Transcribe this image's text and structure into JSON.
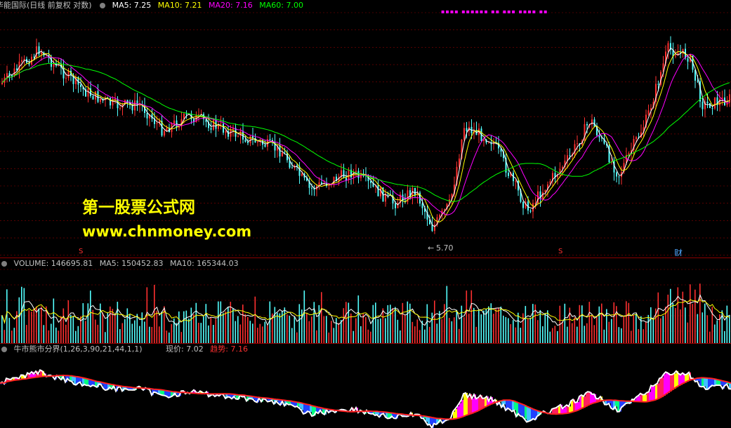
{
  "main_header": {
    "title": "华能国际(日线 前复权 对数)",
    "ma5": "MA5: 7.25",
    "ma10": "MA10: 7.21",
    "ma20": "MA20: 7.16",
    "ma60": "MA60: 7.00"
  },
  "colors": {
    "up": "#ff3030",
    "down": "#54ffff",
    "ma5": "#ffffff",
    "ma10": "#ffff00",
    "ma20": "#ff00ff",
    "ma60": "#00ff00",
    "grid": "#8b0000"
  },
  "watermark": {
    "line1": "第一股票公式网",
    "line2": "www.chnmoney.com"
  },
  "annotations": {
    "low_arrow": "←",
    "low_value": "5.70",
    "cai": "财",
    "s_mark": "S"
  },
  "top_dots": "▪▪▪▪ ▪▪▪▪▪▪ ▪▪ ▪▪▪ ▪▪▪▪ ▪▪",
  "volume_header": {
    "volume": "VOLUME: 146695.81",
    "ma5": "MA5: 150452.83",
    "ma10": "MA10: 165344.03"
  },
  "indicator_header": {
    "name": "牛市熊市分界(1,26,3,90,21,44,1,1)",
    "price": "现价: 7.02",
    "trend_label": "趋势: 7.16"
  },
  "icons": [
    "settings-dot-icon"
  ],
  "chart_data": [
    {
      "type": "candlestick",
      "title": "华能国际(日线 前复权 对数)",
      "series": [
        {
          "name": "MA5",
          "value": 7.25
        },
        {
          "name": "MA10",
          "value": 7.21
        },
        {
          "name": "MA20",
          "value": 7.16
        },
        {
          "name": "MA60",
          "value": 7.0
        }
      ],
      "annotations": [
        "5.70"
      ]
    },
    {
      "type": "bar",
      "title": "VOLUME",
      "series": [
        {
          "name": "VOLUME",
          "value": 146695.81
        },
        {
          "name": "MA5",
          "value": 150452.83
        },
        {
          "name": "MA10",
          "value": 165344.03
        }
      ]
    },
    {
      "type": "area",
      "title": "牛市熊市分界(1,26,3,90,21,44,1,1)",
      "series": [
        {
          "name": "现价",
          "value": 7.02
        },
        {
          "name": "趋势",
          "value": 7.16
        }
      ]
    }
  ]
}
